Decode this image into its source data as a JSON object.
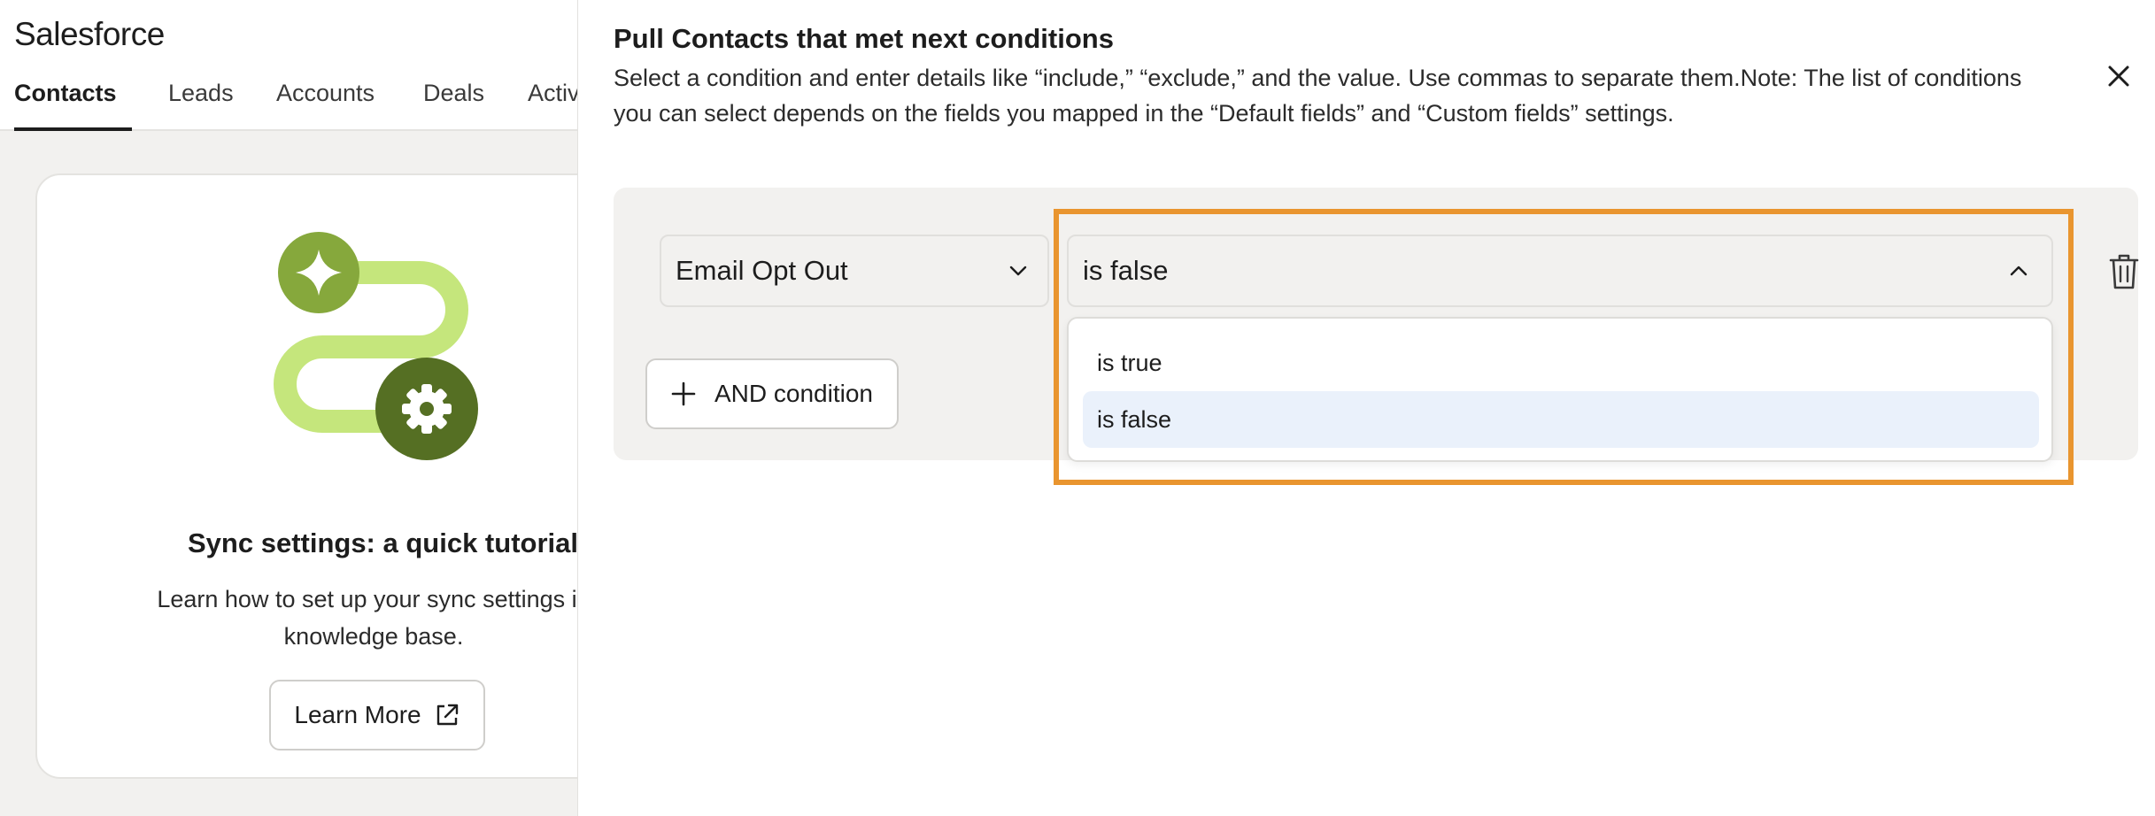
{
  "app": {
    "title": "Salesforce"
  },
  "tabs": [
    {
      "label": "Contacts",
      "active": true
    },
    {
      "label": "Leads",
      "active": false
    },
    {
      "label": "Accounts",
      "active": false
    },
    {
      "label": "Deals",
      "active": false
    },
    {
      "label": "Activ",
      "active": false
    }
  ],
  "tutorial": {
    "title": "Sync settings: a quick tutorial",
    "description": "Learn how to set up your sync settings in knowledge base.",
    "button_label": "Learn More"
  },
  "drawer": {
    "title": "Pull Contacts that met next conditions",
    "description": "Select a condition and enter details like “include,” “exclude,” and the value. Use commas to separate them.Note: The list of conditions you can select depends on the fields you mapped in the “Default fields” and “Custom fields” settings.",
    "field_select_value": "Email Opt Out",
    "operator_select_value": "is false",
    "and_condition_label": "AND condition",
    "options": [
      {
        "label": "is true",
        "selected": false
      },
      {
        "label": "is false",
        "selected": true
      }
    ]
  },
  "colors": {
    "highlight": "#e9952f",
    "illustration_light_green": "#c5e67c",
    "illustration_mid_green": "#86a83c",
    "illustration_dark_green": "#556f23",
    "selected_option_bg": "#eaf1fb"
  },
  "icons": {
    "close": "close-icon",
    "chevron_down": "chevron-down-icon",
    "chevron_up": "chevron-up-icon",
    "trash": "trash-icon",
    "plus": "plus-icon",
    "external_link": "external-link-icon",
    "sparkle": "sparkle-icon",
    "gear": "gear-icon"
  }
}
